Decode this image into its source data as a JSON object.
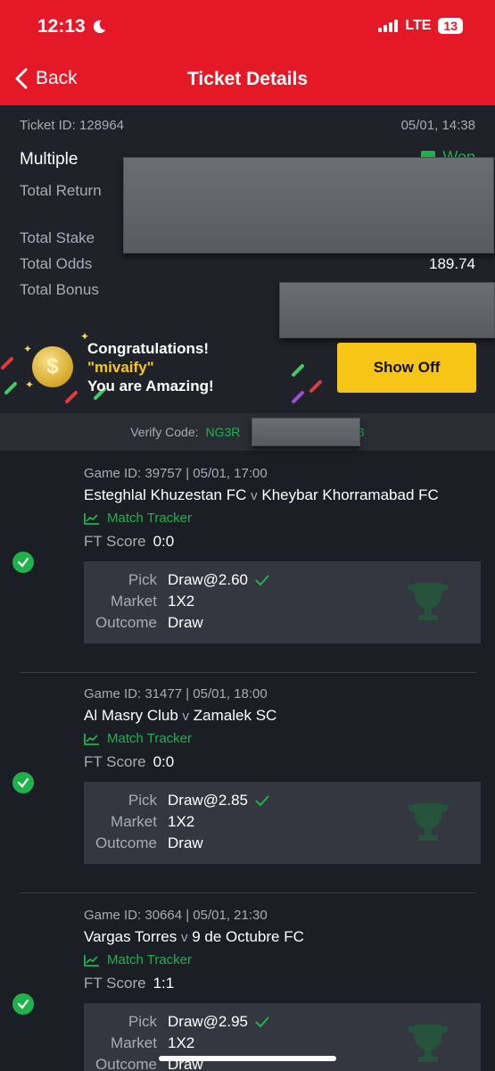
{
  "status": {
    "time": "12:13",
    "network": "LTE",
    "battery": "13"
  },
  "nav": {
    "back_label": "Back",
    "title": "Ticket Details"
  },
  "ticket": {
    "id_label": "Ticket ID: 128964",
    "date": "05/01, 14:38",
    "type": "Multiple",
    "status": "Won",
    "total_return_label": "Total Return",
    "total_stake_label": "Total Stake",
    "total_odds_label": "Total Odds",
    "total_odds_value": "189.74",
    "total_bonus_label": "Total Bonus"
  },
  "promo": {
    "line1": "Congratulations!",
    "user": "\"mivaify\"",
    "line3": "You are Amazing!",
    "button": "Show Off"
  },
  "verify": {
    "label": "Verify Code:",
    "code_start": "NG3R",
    "code_end": "B"
  },
  "labels": {
    "match_tracker": "Match Tracker",
    "ft_score": "FT Score",
    "pick": "Pick",
    "market": "Market",
    "outcome": "Outcome",
    "vs": "v"
  },
  "games": [
    {
      "meta": "Game ID: 39757 | 05/01, 17:00",
      "home": "Esteghlal Khuzestan FC",
      "away": "Kheybar Khorramabad FC",
      "score": "0:0",
      "pick": "Draw@2.60",
      "market": "1X2",
      "outcome": "Draw"
    },
    {
      "meta": "Game ID: 31477 | 05/01, 18:00",
      "home": "Al Masry Club",
      "away": "Zamalek SC",
      "score": "0:0",
      "pick": "Draw@2.85",
      "market": "1X2",
      "outcome": "Draw"
    },
    {
      "meta": "Game ID: 30664 | 05/01, 21:30",
      "home": "Vargas Torres",
      "away": "9 de Octubre FC",
      "score": "1:1",
      "pick": "Draw@2.95",
      "market": "1X2",
      "outcome": "Draw"
    }
  ],
  "colors": {
    "brand_red": "#e41827",
    "win_green": "#1fb24a",
    "cta_yellow": "#f7c515"
  }
}
